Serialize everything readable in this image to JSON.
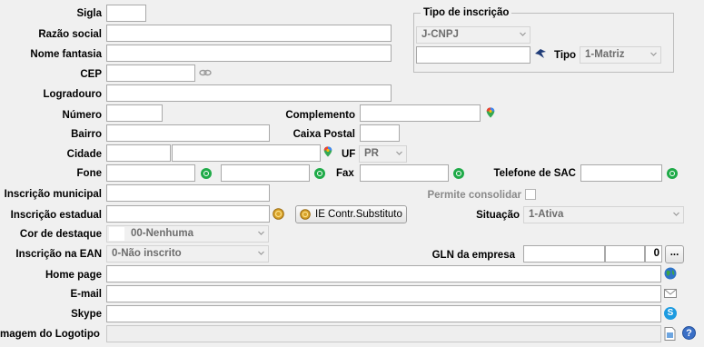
{
  "labels": {
    "sigla": "Sigla",
    "razao_social": "Razão social",
    "nome_fantasia": "Nome fantasia",
    "cep": "CEP",
    "logradouro": "Logradouro",
    "numero": "Número",
    "complemento": "Complemento",
    "bairro": "Bairro",
    "caixa_postal": "Caixa Postal",
    "cidade": "Cidade",
    "uf": "UF",
    "fone": "Fone",
    "fax": "Fax",
    "telefone_sac": "Telefone de SAC",
    "inscricao_municipal": "Inscrição municipal",
    "permite_consolidar": "Permite consolidar",
    "inscricao_estadual": "Inscrição estadual",
    "situacao": "Situação",
    "cor_destaque": "Cor de destaque",
    "inscricao_ean": "Inscrição na EAN",
    "gln_empresa": "GLN da empresa",
    "home_page": "Home page",
    "email": "E-mail",
    "skype": "Skype",
    "logotipo": "magem do Logotipo"
  },
  "tipo_inscricao": {
    "legend": "Tipo de inscrição",
    "doc_type": "J-CNPJ",
    "tipo_label": "Tipo",
    "tipo_value": "1-Matriz"
  },
  "values": {
    "uf": "PR",
    "situacao": "1-Ativa",
    "cor_destaque": "00-Nenhuma",
    "inscricao_ean": "0-Não inscrito",
    "gln_digit": "0"
  },
  "buttons": {
    "ie_substituto": "IE Contr.Substituto",
    "gln_more": "..."
  },
  "icons": {
    "whatsapp": "whatsapp-icon",
    "maps": "map-pin-icon",
    "cep_lookup": "link-icon",
    "globe": "globe-icon",
    "email": "envelope-icon",
    "skype": "skype-icon",
    "coins": "coins-icon",
    "logo_pick": "image-file-icon",
    "help": "help-icon",
    "bird": "receita-federal-icon"
  },
  "colors": {
    "whatsapp": "#1faa48",
    "skype": "#1d9be0",
    "help": "#3a6fc6"
  }
}
